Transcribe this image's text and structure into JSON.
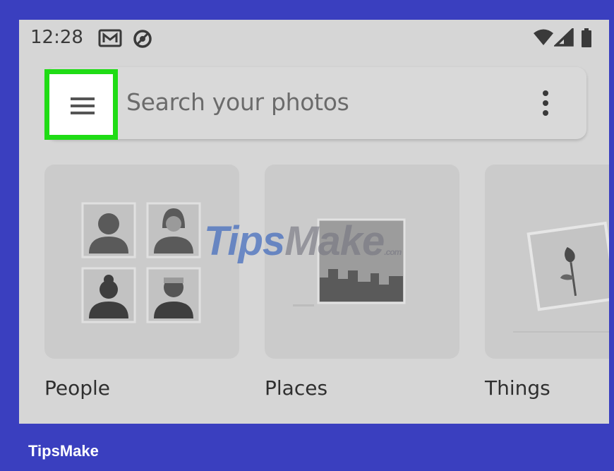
{
  "status_bar": {
    "time": "12:28",
    "icons": [
      "gmail-icon",
      "sync-icon",
      "wifi-icon",
      "signal-icon",
      "battery-icon"
    ]
  },
  "search": {
    "placeholder": "Search your photos",
    "menu_icon": "hamburger-menu-icon",
    "more_icon": "more-vert-icon",
    "highlight_color": "#1fdc15"
  },
  "categories": [
    {
      "label": "People"
    },
    {
      "label": "Places"
    },
    {
      "label": "Things"
    }
  ],
  "watermark": {
    "text_a": "Tips",
    "text_b": "Make",
    "suffix": ".com"
  },
  "footer": {
    "brand": "TipsMake",
    "background": "#3a3fbf"
  }
}
